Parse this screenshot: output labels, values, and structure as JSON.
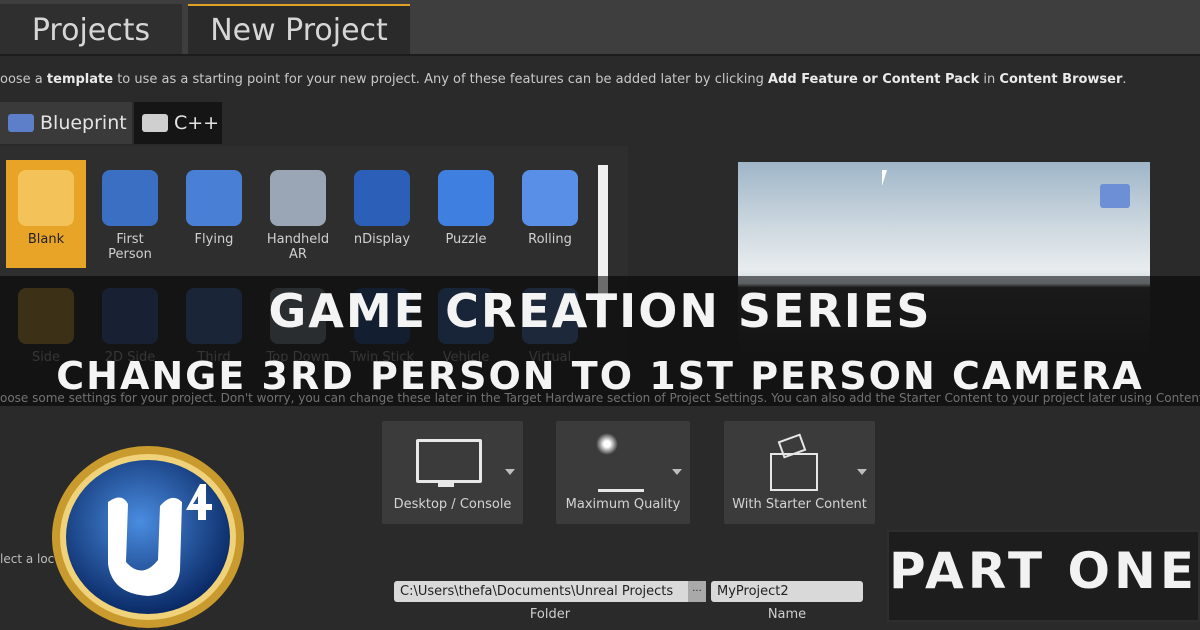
{
  "tabs": {
    "projects": "Projects",
    "new_project": "New Project"
  },
  "instructions": {
    "prefix": "oose a ",
    "bold1": "template",
    "mid": " to use as a starting point for your new project.  Any of these features can be added later by clicking ",
    "bold2": "Add Feature or Content Pack",
    "mid2": " in ",
    "bold3": "Content Browser",
    "end": "."
  },
  "lang_tabs": {
    "blueprint": "Blueprint",
    "cpp": "C++"
  },
  "templates_row1": [
    "Blank",
    "First\nPerson",
    "Flying",
    "Handheld\nAR",
    "nDisplay",
    "Puzzle",
    "Rolling"
  ],
  "templates_row2": [
    "Side",
    "2D Side",
    "Third",
    "Top Down",
    "Twin Stick",
    "Vehicle",
    "Virtual"
  ],
  "overlay": {
    "title": "GAME CREATION SERIES",
    "subtitle": "CHANGE 3RD PERSON TO 1ST PERSON CAMERA",
    "part": "PART ONE"
  },
  "settings_instr": "oose some settings for your project.  Don't worry, you can change these later in the Target Hardware section of Project Settings.  You can also add the Starter Content to your project later using Content Browser",
  "settings_cards": [
    {
      "label": "Desktop / Console",
      "icon": "monitor-icon"
    },
    {
      "label": "Maximum Quality",
      "icon": "quality-plant-icon"
    },
    {
      "label": "With Starter Content",
      "icon": "starter-box-icon"
    }
  ],
  "location_text": "lect a loc",
  "folder": {
    "value": "C:\\Users\\thefa\\Documents\\Unreal Projects",
    "label": "Folder",
    "browse": "···"
  },
  "name": {
    "value": "MyProject2",
    "label": "Name"
  },
  "colors": {
    "accent": "#e8a427",
    "panel": "#2e2e2e",
    "background": "#2a2a2a"
  }
}
